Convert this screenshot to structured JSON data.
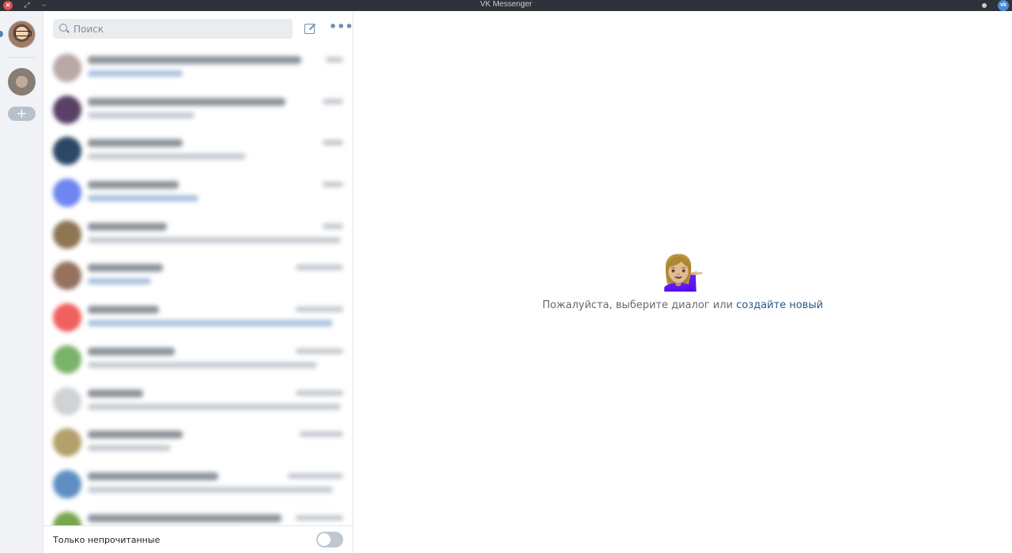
{
  "window": {
    "title": "VK Messenger",
    "close_glyph": "×",
    "restore_glyph": "⤢",
    "minimize_glyph": "–",
    "vk_badge": "vk"
  },
  "accounts": {
    "add_glyph": "+"
  },
  "search": {
    "placeholder": "Поиск"
  },
  "toolbar": {
    "more_glyph": "•••"
  },
  "footer": {
    "unread_only_label": "Только непрочитанные",
    "unread_only_enabled": false
  },
  "empty_state": {
    "emoji": "💁🏼‍♀️",
    "text": "Пожалуйста, выберите диалог или",
    "link": "создайте новый"
  },
  "colors": {
    "accent": "#5181b8",
    "link": "#2a5885",
    "titlebar": "#2f3238",
    "sidebar": "#f0f2f5"
  },
  "icons": {
    "search": "search-icon",
    "compose": "compose-icon",
    "more": "more-icon",
    "close": "close-icon"
  }
}
